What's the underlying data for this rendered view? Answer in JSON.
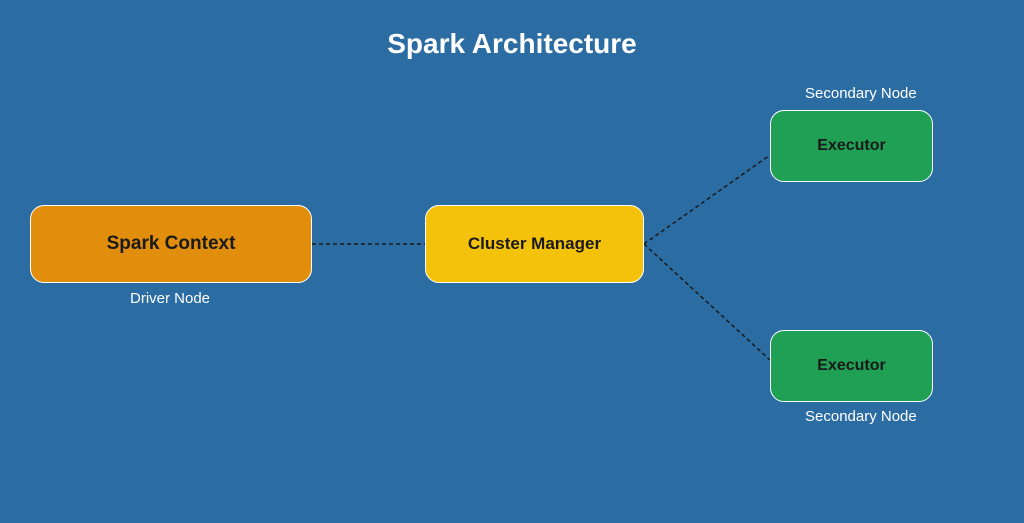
{
  "title": "Spark Architecture",
  "nodes": {
    "context": {
      "label": "Spark Context",
      "caption": "Driver Node"
    },
    "manager": {
      "label": "Cluster Manager"
    },
    "exec1": {
      "label": "Executor",
      "caption": "Secondary Node"
    },
    "exec2": {
      "label": "Executor",
      "caption": "Secondary Node"
    }
  }
}
